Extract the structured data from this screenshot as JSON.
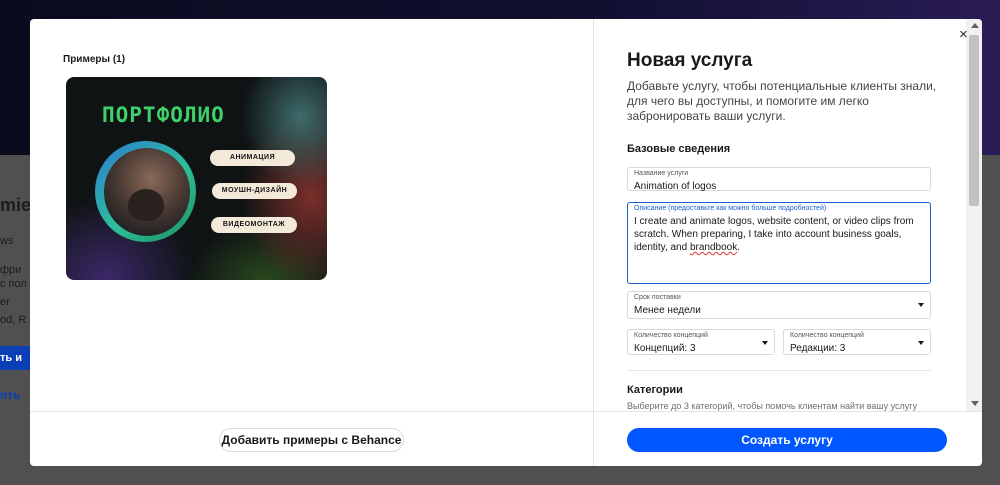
{
  "background": {
    "fragments": [
      "mie",
      "ws",
      "фри",
      "с пол",
      "er",
      "od, R"
    ],
    "button_fragment": "ть и",
    "link_fragment": "пть"
  },
  "modal": {
    "close_icon": "×",
    "examples": {
      "title": "Примеры (1)",
      "card": {
        "heading": "ПОРТФОЛИО",
        "tags": [
          "АНИМАЦИЯ",
          "МОУШН-ДИЗАЙН",
          "ВИДЕОМОНТАЖ"
        ]
      },
      "add_button": "Добавить примеры с Behance"
    },
    "service": {
      "title": "Новая услуга",
      "description": "Добавьте услугу, чтобы потенциальные клиенты знали, для чего вы доступны, и помогите им легко забронировать ваши услуги.",
      "basics_title": "Базовые сведения",
      "name_field": {
        "label": "Название услуги",
        "value": "Animation of logos"
      },
      "description_field": {
        "label": "Описание (предоставьте как можно больше подробностей)",
        "value_main": "I create and animate logos, website content, or video clips from scratch. When preparing, I take into account business goals, identity, and ",
        "value_misspelled": "brandbook",
        "value_end": "."
      },
      "delivery_field": {
        "label": "Срок поставки",
        "value": "Менее недели"
      },
      "concepts_field": {
        "label": "Количество концепций",
        "value": "Концепций: 3"
      },
      "revisions_field": {
        "label": "Количество концепций",
        "value": "Редакции: 3"
      },
      "categories": {
        "title": "Категории",
        "subtitle": "Выберите до 3 категорий, чтобы помочь клиентам найти вашу услугу"
      },
      "submit_button": "Создать услугу"
    }
  },
  "colors": {
    "primary": "#0057ff",
    "focus": "#1a5fd0",
    "portfolio_green": "#3fd06a",
    "pill_bg": "#f2e9d8"
  }
}
